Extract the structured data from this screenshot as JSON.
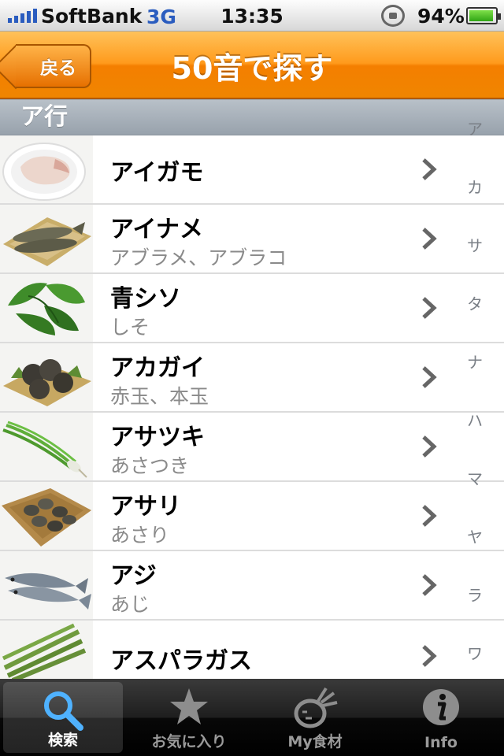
{
  "status": {
    "carrier": "SoftBank",
    "network": "3G",
    "time": "13:35",
    "battery": "94%",
    "battery_level": 0.94,
    "signal_bars": 5
  },
  "nav": {
    "back_label": "戻る",
    "title": "50音で探す"
  },
  "section": {
    "header": "ア行"
  },
  "items": [
    {
      "name": "アイガモ",
      "sub": "",
      "thumb": "duck-meat"
    },
    {
      "name": "アイナメ",
      "sub": "アブラメ、アブラコ",
      "thumb": "fish"
    },
    {
      "name": "青シソ",
      "sub": "しそ",
      "thumb": "shiso-leaves"
    },
    {
      "name": "アカガイ",
      "sub": "赤玉、本玉",
      "thumb": "clams"
    },
    {
      "name": "アサツキ",
      "sub": "あさつき",
      "thumb": "chives"
    },
    {
      "name": "アサリ",
      "sub": "あさり",
      "thumb": "asari-basket"
    },
    {
      "name": "アジ",
      "sub": "あじ",
      "thumb": "horse-mackerel"
    },
    {
      "name": "アスパラガス",
      "sub": "",
      "thumb": "asparagus"
    }
  ],
  "index": [
    "ア",
    "カ",
    "サ",
    "タ",
    "ナ",
    "ハ",
    "マ",
    "ヤ",
    "ラ",
    "ワ"
  ],
  "tabs": [
    {
      "label": "検索",
      "icon": "search-icon",
      "active": true
    },
    {
      "label": "お気に入り",
      "icon": "star-icon",
      "active": false
    },
    {
      "label": "My食材",
      "icon": "vegetable-icon",
      "active": false
    },
    {
      "label": "Info",
      "icon": "info-icon",
      "active": false
    }
  ],
  "colors": {
    "nav_orange": "#ff9a1c",
    "status_blue": "#2a5cbf",
    "tab_active": "#3aa0ff"
  }
}
